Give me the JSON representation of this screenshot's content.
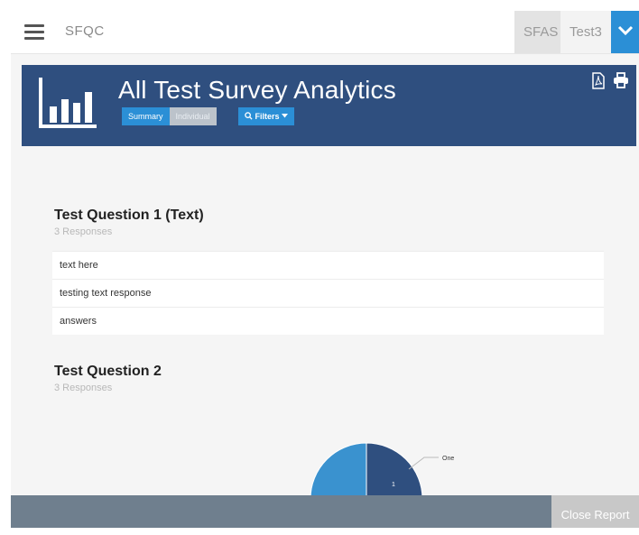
{
  "app": {
    "brand": "SFQC",
    "tabs": [
      {
        "label": "SFAS"
      },
      {
        "label": "Test3"
      }
    ]
  },
  "report": {
    "title": "All Test Survey Analytics",
    "summary_label": "Summary",
    "individual_label": "Individual",
    "filters_label": "Filters"
  },
  "questions": [
    {
      "title": "Test Question 1 (Text)",
      "responses": "3 Responses",
      "answers": [
        "text here",
        "testing text response",
        "answers"
      ]
    },
    {
      "title": "Test Question 2",
      "responses": "3 Responses",
      "chart_data": {
        "type": "pie",
        "categories": [
          "One"
        ],
        "values": [
          1
        ],
        "colors": [
          "#2f4f7f",
          "#3a92cf"
        ]
      }
    }
  ],
  "footer": {
    "close_label": "Close Report"
  }
}
